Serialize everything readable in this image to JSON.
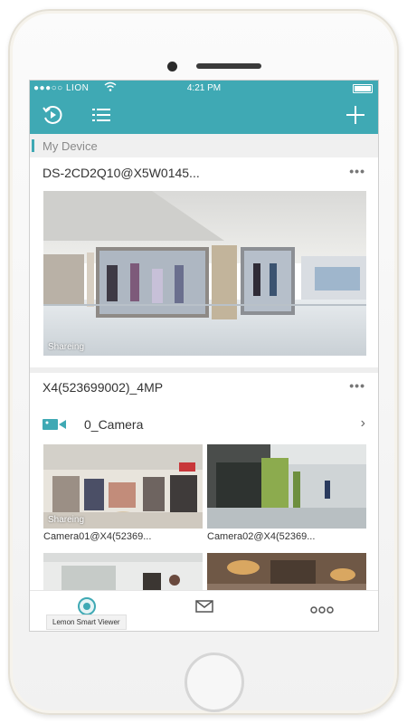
{
  "status": {
    "carrier": "●●●○○ LION",
    "time": "4:21 PM"
  },
  "colors": {
    "accent": "#3fa9b4"
  },
  "navbar": {
    "left_icons": [
      "playback-icon",
      "list-icon"
    ],
    "right_icon": "add-icon"
  },
  "section": {
    "title": "My Device"
  },
  "devices": [
    {
      "title": "DS-2CD2Q10@X5W0145...",
      "preview_overlay": "Shareing"
    },
    {
      "title": "X4(523699002)_4MP",
      "channel": {
        "name": "0_Camera"
      },
      "cameras": [
        {
          "caption": "Camera01@X4(52369...",
          "overlay": "Shareing"
        },
        {
          "caption": "Camera02@X4(52369...",
          "overlay": ""
        }
      ]
    }
  ],
  "tabbar": {
    "active_label": "Lemon Smart Viewer",
    "tabs": [
      "camera-tab-icon",
      "message-tab-icon",
      "more-tab-icon"
    ]
  }
}
